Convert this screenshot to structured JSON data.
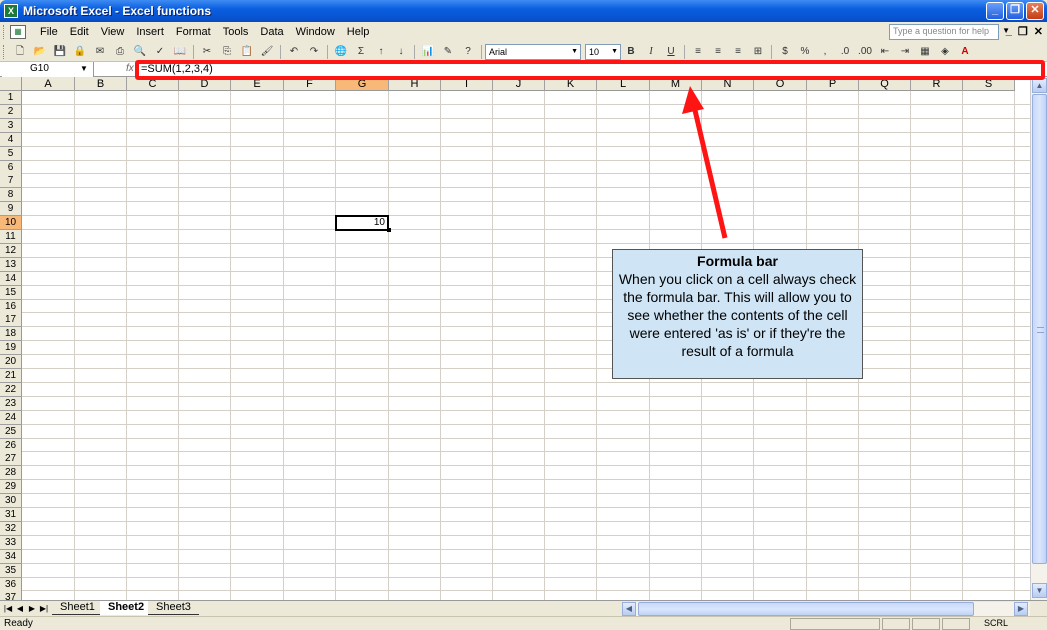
{
  "window": {
    "title": "Microsoft Excel - Excel functions",
    "app_icon": "excel-icon"
  },
  "menu": [
    "File",
    "Edit",
    "View",
    "Insert",
    "Format",
    "Tools",
    "Data",
    "Window",
    "Help"
  ],
  "help_placeholder": "Type a question for help",
  "toolbar": {
    "font": "Arial",
    "size": "10",
    "sum": "Σ",
    "bold": "B",
    "italic": "I",
    "underline": "U",
    "percent": "%",
    "comma": ",",
    "font_color": "A"
  },
  "formula_bar": {
    "name_box": "G10",
    "fx": "fx",
    "formula": "=SUM(1,2,3,4)"
  },
  "grid": {
    "columns": [
      "A",
      "B",
      "C",
      "D",
      "E",
      "F",
      "G",
      "H",
      "I",
      "J",
      "K",
      "L",
      "M",
      "N",
      "O",
      "P",
      "Q",
      "R",
      "S"
    ],
    "rows": [
      "1",
      "2",
      "3",
      "4",
      "5",
      "6",
      "7",
      "8",
      "9",
      "10",
      "11",
      "12",
      "13",
      "14",
      "15",
      "16",
      "17",
      "18",
      "19",
      "20",
      "21",
      "22",
      "23",
      "24",
      "25",
      "26",
      "27",
      "28",
      "29",
      "30",
      "31",
      "32",
      "33",
      "34",
      "35",
      "36",
      "37"
    ],
    "active_col": "G",
    "active_row": "10",
    "active_value": "10"
  },
  "sheets": [
    "Sheet1",
    "Sheet2",
    "Sheet3"
  ],
  "active_sheet": "Sheet2",
  "status": {
    "left": "Ready",
    "scrl": "SCRL"
  },
  "callout": {
    "title": "Formula bar",
    "body": "When you click on a cell always check the formula bar. This will allow you to see whether the contents of the cell were entered 'as is' or if they're the result of a formula"
  },
  "annotation_color": "#ff1414"
}
